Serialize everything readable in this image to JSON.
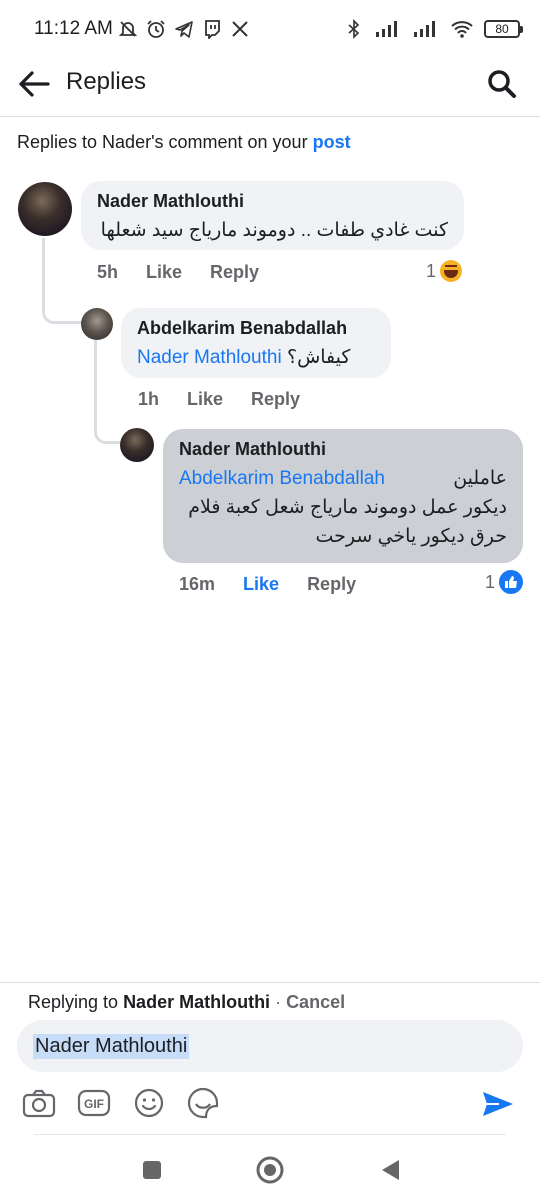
{
  "status_bar": {
    "time": "11:12 AM",
    "battery": "80",
    "icons_left": [
      "mute-icon",
      "alarm-icon",
      "telegram-icon",
      "twitch-icon",
      "x-icon"
    ],
    "icons_right": [
      "bluetooth-icon",
      "signal-icon",
      "signal-icon",
      "wifi-icon",
      "battery-icon"
    ]
  },
  "header": {
    "title": "Replies"
  },
  "context": {
    "prefix": "Replies to Nader's comment on your ",
    "link": "post"
  },
  "comments": [
    {
      "author": "Nader Mathlouthi",
      "text": "كنت غادي طفات .. دوموند مارياج سيد شعلها",
      "time": "5h",
      "like": "Like",
      "reply": "Reply",
      "reaction_count": "1",
      "reaction_type": "haha"
    },
    {
      "author": "Abdelkarim Benabdallah",
      "mention": "Nader Mathlouthi",
      "text": "كيفاش؟",
      "time": "1h",
      "like": "Like",
      "reply": "Reply"
    },
    {
      "author": "Nader Mathlouthi",
      "mention": "Abdelkarim Benabdallah",
      "text_line1": "عاملين",
      "text_line2": "ديكور عمل دوموند مارياج شعل كعبة فلام",
      "text_line3": "حرق ديكور ياخي سرحت",
      "time": "16m",
      "like": "Like",
      "reply": "Reply",
      "reaction_count": "1",
      "reaction_type": "like"
    }
  ],
  "composer": {
    "replying_prefix": "Replying to ",
    "replying_name": "Nader Mathlouthi",
    "separator": " · ",
    "cancel": "Cancel",
    "input_value": "Nader Mathlouthi",
    "tools": [
      "camera-icon",
      "gif-icon",
      "emoji-icon",
      "sticker-icon"
    ],
    "gif_label": "GIF"
  },
  "colors": {
    "accent": "#1877f2",
    "bubble": "#f0f2f5",
    "bubble_active": "#ccd0d5",
    "secondary_text": "#65676b"
  }
}
